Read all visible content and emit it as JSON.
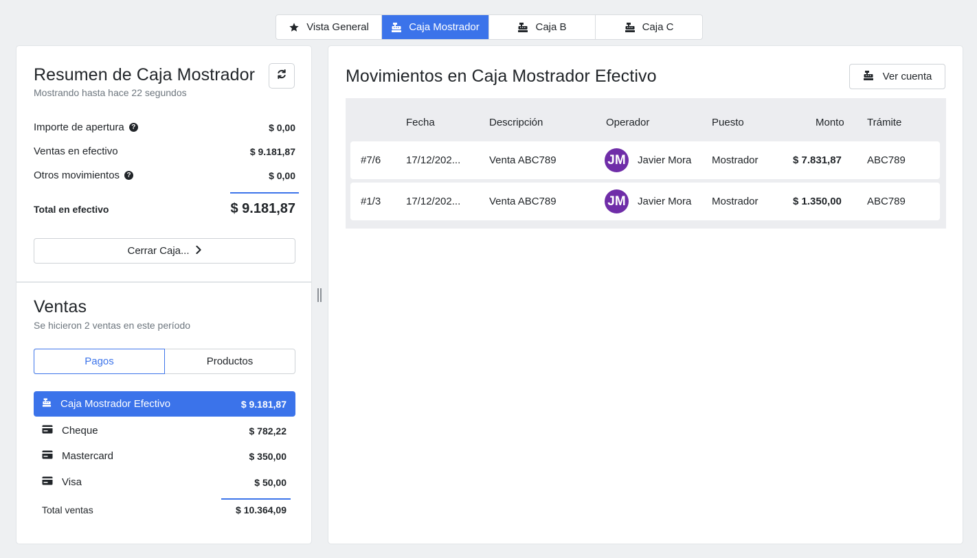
{
  "tabs": [
    {
      "label": "Vista General",
      "icon": "star-icon"
    },
    {
      "label": "Caja Mostrador",
      "icon": "cash-register-icon",
      "active": true
    },
    {
      "label": "Caja B",
      "icon": "cash-register-icon"
    },
    {
      "label": "Caja C",
      "icon": "cash-register-icon"
    }
  ],
  "resumen": {
    "title": "Resumen de Caja Mostrador",
    "subtitle": "Mostrando hasta hace 22 segundos",
    "rows": [
      {
        "label": "Importe de apertura",
        "value": "$ 0,00",
        "help": true
      },
      {
        "label": "Ventas en efectivo",
        "value": "$ 9.181,87",
        "help": false
      },
      {
        "label": "Otros movimientos",
        "value": "$ 0,00",
        "help": true
      }
    ],
    "total_label": "Total en efectivo",
    "total_value": "$ 9.181,87",
    "close_button": "Cerrar Caja..."
  },
  "ventas": {
    "title": "Ventas",
    "subtitle": "Se hicieron 2 ventas en este período",
    "tabs": [
      "Pagos",
      "Productos"
    ],
    "payments": [
      {
        "label": "Caja Mostrador Efectivo",
        "value": "$ 9.181,87",
        "icon": "cash-register-icon"
      },
      {
        "label": "Cheque",
        "value": "$ 782,22",
        "icon": "credit-card-icon"
      },
      {
        "label": "Mastercard",
        "value": "$ 350,00",
        "icon": "credit-card-icon"
      },
      {
        "label": "Visa",
        "value": "$ 50,00",
        "icon": "credit-card-icon"
      }
    ],
    "total_label": "Total ventas",
    "total_value": "$ 10.364,09"
  },
  "movimientos": {
    "title": "Movimientos en Caja Mostrador Efectivo",
    "ver_button": "Ver cuenta",
    "headers": {
      "fecha": "Fecha",
      "descripcion": "Descripción",
      "operador": "Operador",
      "puesto": "Puesto",
      "monto": "Monto",
      "tramite": "Trámite"
    },
    "rows": [
      {
        "id": "#7/6",
        "fecha": "17/12/202...",
        "descripcion": "Venta ABC789",
        "initials": "JM",
        "operador": "Javier Mora",
        "puesto": "Mostrador",
        "monto": "$ 7.831,87",
        "tramite": "ABC789"
      },
      {
        "id": "#1/3",
        "fecha": "17/12/202...",
        "descripcion": "Venta ABC789",
        "initials": "JM",
        "operador": "Javier Mora",
        "puesto": "Mostrador",
        "monto": "$ 1.350,00",
        "tramite": "ABC789"
      }
    ]
  },
  "colors": {
    "accent": "#3b73ea",
    "avatar": "#6f2da8"
  }
}
